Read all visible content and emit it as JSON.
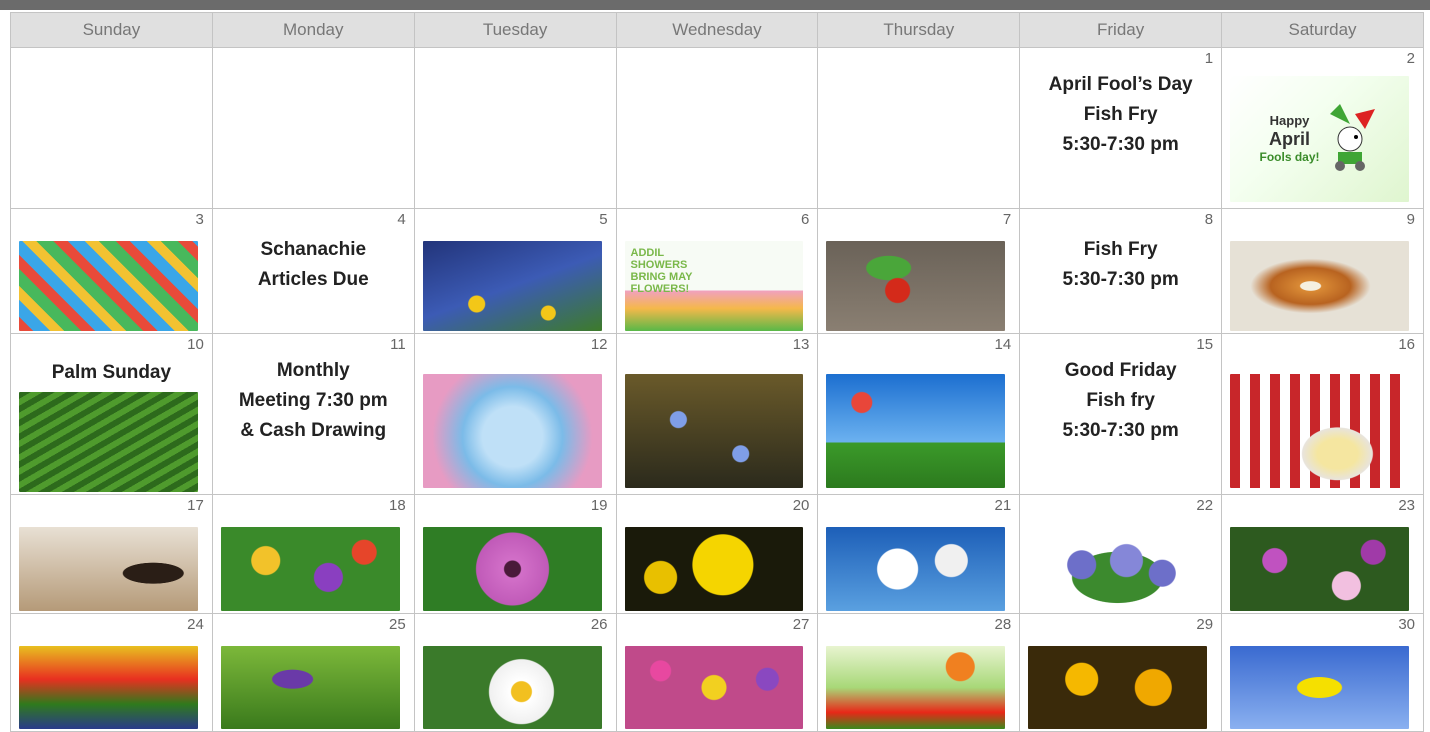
{
  "calendar": {
    "weekdays": [
      "Sunday",
      "Monday",
      "Tuesday",
      "Wednesday",
      "Thursday",
      "Friday",
      "Saturday"
    ],
    "days": {
      "d1": "1",
      "d2": "2",
      "d3": "3",
      "d4": "4",
      "d5": "5",
      "d6": "6",
      "d7": "7",
      "d8": "8",
      "d9": "9",
      "d10": "10",
      "d11": "11",
      "d12": "12",
      "d13": "13",
      "d14": "14",
      "d15": "15",
      "d16": "16",
      "d17": "17",
      "d18": "18",
      "d19": "19",
      "d20": "20",
      "d21": "21",
      "d22": "22",
      "d23": "23",
      "d24": "24",
      "d25": "25",
      "d26": "26",
      "d27": "27",
      "d28": "28",
      "d29": "29",
      "d30": "30"
    },
    "events": {
      "april1": [
        "April Fool’s Day",
        "Fish Fry",
        "5:30-7:30 pm"
      ],
      "april4": [
        "Schanachie",
        "Articles Due"
      ],
      "april8": [
        "Fish Fry",
        "5:30-7:30 pm"
      ],
      "april10": "Palm Sunday",
      "april11": [
        "Monthly",
        "Meeting 7:30 pm",
        "& Cash Drawing"
      ],
      "april15": [
        "Good Friday",
        "Fish fry",
        "5:30-7:30 pm"
      ]
    },
    "images": {
      "april2_text": [
        "Happy",
        "April",
        "Fools day!"
      ],
      "april6_text": [
        "ADDIL",
        "SHOWERS",
        "BRING MAY",
        "FLOWERS!"
      ]
    },
    "colors": {
      "header_bg": "#e0e0e0",
      "grid_line": "#c4c4c4",
      "top_bar": "#6b6b6b"
    }
  }
}
